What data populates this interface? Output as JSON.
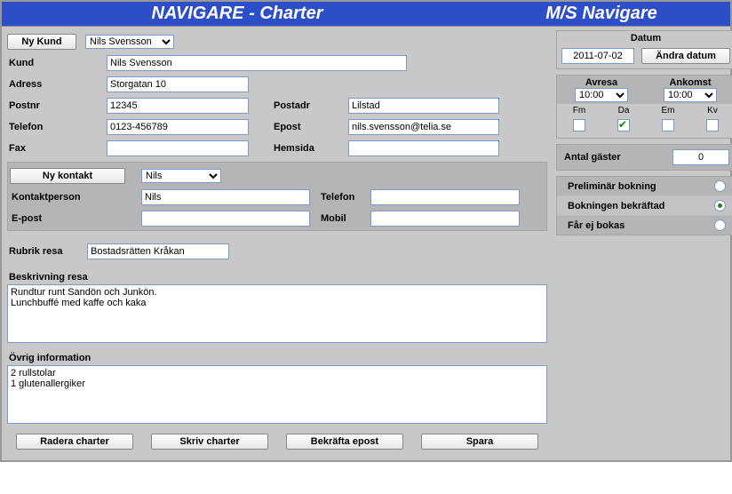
{
  "header": {
    "left": "NAVIGARE - Charter",
    "right": "M/S Navigare"
  },
  "buttons": {
    "nyKund": "Ny Kund",
    "nyKontakt": "Ny kontakt",
    "andraDatum": "Ändra datum",
    "raderaCharter": "Radera charter",
    "skrivCharter": "Skriv charter",
    "bekraftaEpost": "Bekräfta epost",
    "spara": "Spara"
  },
  "selects": {
    "kundSelected": "Nils Svensson",
    "kontaktSelected": "Nils",
    "avresaTime": "10:00",
    "ankomstTime": "10:00"
  },
  "labels": {
    "kund": "Kund",
    "adress": "Adress",
    "postnr": "Postnr",
    "postadr": "Postadr",
    "telefon": "Telefon",
    "epost": "Epost",
    "fax": "Fax",
    "hemsida": "Hemsida",
    "kontaktperson": "Kontaktperson",
    "kTelefon": "Telefon",
    "kEpost": "E-post",
    "kMobil": "Mobil",
    "rubrik": "Rubrik resa",
    "beskrivning": "Beskrivning resa",
    "ovrig": "Övrig information",
    "datum": "Datum",
    "avresa": "Avresa",
    "ankomst": "Ankomst",
    "fm": "Fm",
    "da": "Da",
    "em": "Em",
    "kv": "Kv",
    "antalGaster": "Antal gäster",
    "prelim": "Preliminär bokning",
    "bekraftad": "Bokningen bekräftad",
    "ejBokas": "Får ej bokas"
  },
  "values": {
    "kund": "Nils Svensson",
    "adress": "Storgatan 10",
    "postnr": "12345",
    "postadr": "Lilstad",
    "telefon": "0123-456789",
    "epost": "nils.svensson@telia.se",
    "fax": "",
    "hemsida": "",
    "kontaktperson": "Nils",
    "kTelefon": "",
    "kEpost": "",
    "kMobil": "",
    "rubrik": "Bostadsrätten Kråkan",
    "beskrivning": "Rundtur runt Sandön och Junkön.\nLunchbuffé med kaffe och kaka",
    "ovrig": "2 rullstolar\n1 glutenallergiker",
    "datum": "2011-07-02",
    "antalGaster": "0"
  },
  "checks": {
    "fm": false,
    "da": true,
    "em": false,
    "kv": false
  },
  "status": {
    "selected": "bekraftad"
  }
}
